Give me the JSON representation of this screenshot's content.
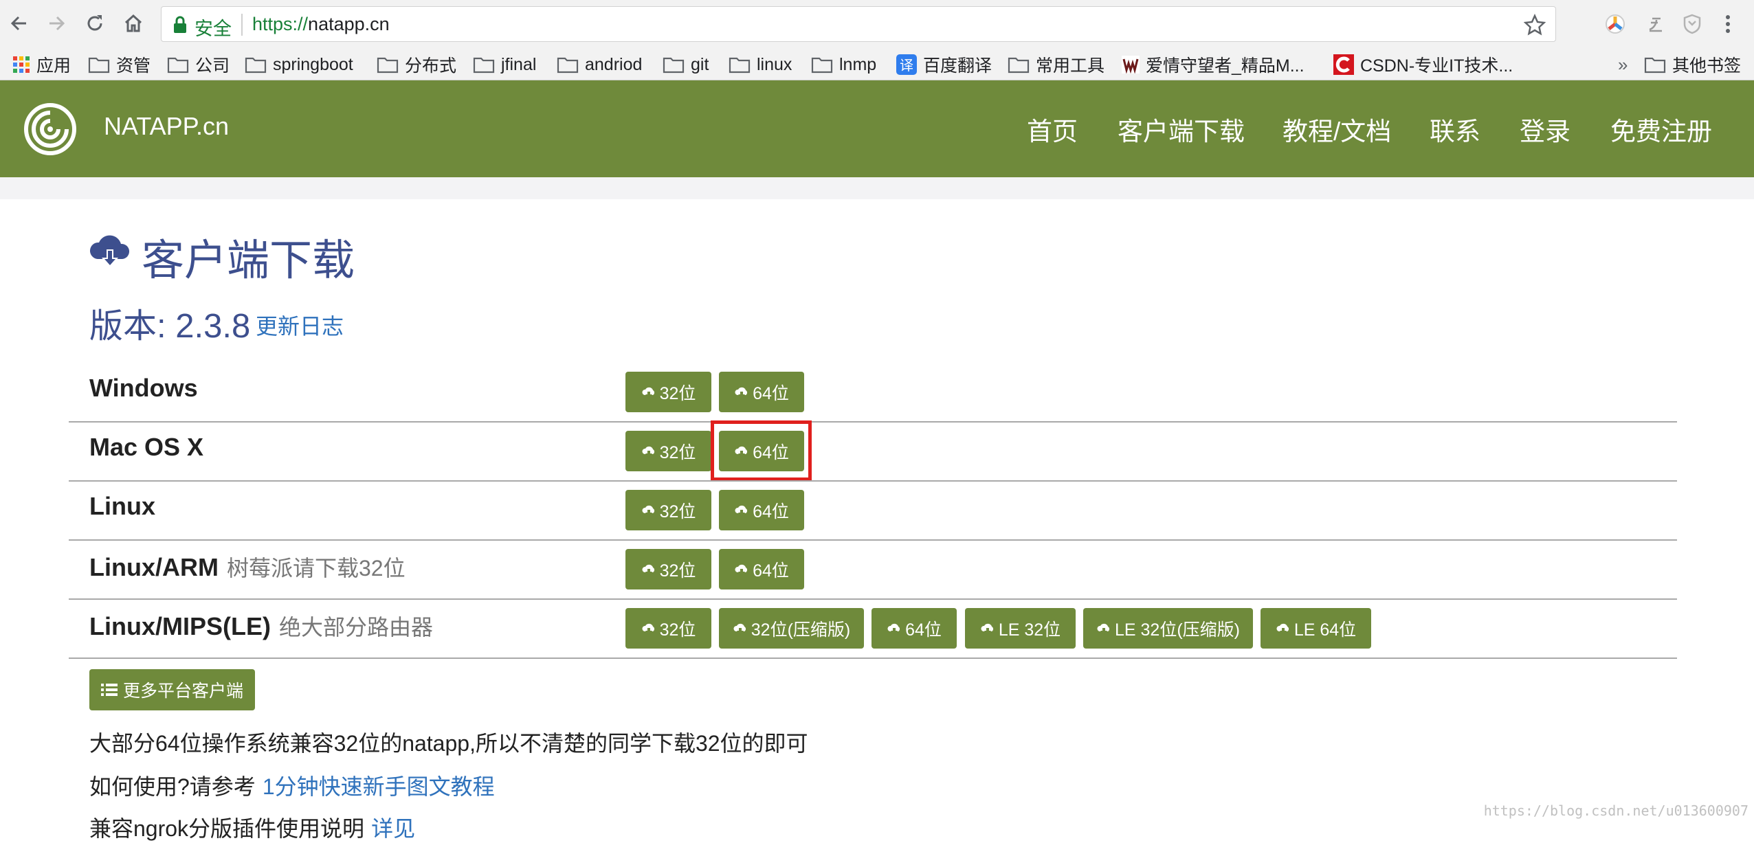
{
  "browser": {
    "secure_label": "安全",
    "url_scheme": "https://",
    "url_host": "natapp.cn"
  },
  "bookmarks": [
    {
      "label": "应用",
      "icon": "apps-grid-icon"
    },
    {
      "label": "资管",
      "icon": "folder-icon"
    },
    {
      "label": "公司",
      "icon": "folder-icon"
    },
    {
      "label": "springboot",
      "icon": "folder-icon"
    },
    {
      "label": "分布式",
      "icon": "folder-icon"
    },
    {
      "label": "jfinal",
      "icon": "folder-icon"
    },
    {
      "label": "andriod",
      "icon": "folder-icon"
    },
    {
      "label": "git",
      "icon": "folder-icon"
    },
    {
      "label": "linux",
      "icon": "folder-icon"
    },
    {
      "label": "lnmp",
      "icon": "folder-icon"
    },
    {
      "label": "百度翻译",
      "icon": "baidu-translate-icon"
    },
    {
      "label": "常用工具",
      "icon": "folder-icon"
    },
    {
      "label": "爱情守望者_精品M...",
      "icon": "site-w-icon"
    },
    {
      "label": "CSDN-专业IT技术...",
      "icon": "csdn-icon"
    },
    {
      "label": "其他书签",
      "icon": "folder-icon"
    }
  ],
  "bookmarks_overflow": "»",
  "site": {
    "brand": "NATAPP.cn",
    "nav": [
      "首页",
      "客户端下载",
      "教程/文档",
      "联系",
      "登录",
      "免费注册"
    ]
  },
  "content": {
    "title": "客户端下载",
    "version_label": "版本: 2.3.8",
    "changelog_link": "更新日志",
    "rows": [
      {
        "name": "Windows",
        "note": "",
        "buttons": [
          "32位",
          "64位"
        ]
      },
      {
        "name": "Mac OS X",
        "note": "",
        "buttons": [
          "32位",
          "64位"
        ]
      },
      {
        "name": "Linux",
        "note": "",
        "buttons": [
          "32位",
          "64位"
        ]
      },
      {
        "name": "Linux/ARM",
        "note": "树莓派请下载32位",
        "buttons": [
          "32位",
          "64位"
        ]
      },
      {
        "name": "Linux/MIPS(LE)",
        "note": "绝大部分路由器",
        "buttons": [
          "32位",
          "32位(压缩版)",
          "64位",
          "LE 32位",
          "LE 32位(压缩版)",
          "LE 64位"
        ]
      }
    ],
    "more_platforms": "更多平台客户端",
    "info_1": "大部分64位操作系统兼容32位的natapp,所以不清楚的同学下载32位的即可",
    "info_2": "如何使用?请参考",
    "info_2_link": "1分钟快速新手图文教程",
    "info_3": "兼容ngrok分版插件使用说明",
    "info_3_link": "详见"
  },
  "watermark": "https://blog.csdn.net/u013600907",
  "colors": {
    "brand_green": "#6f8a3b",
    "title_blue": "#3d4f8e",
    "link_blue": "#2f72bc",
    "highlight_red": "#e0201e"
  }
}
